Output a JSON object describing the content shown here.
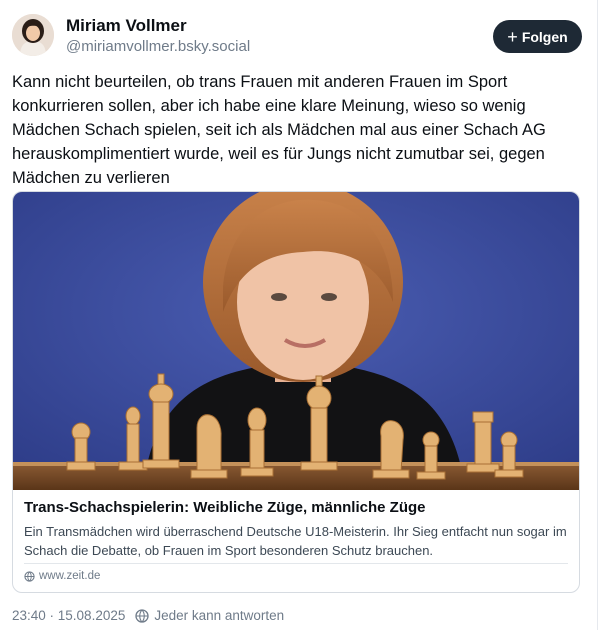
{
  "author": {
    "name": "Miriam Vollmer",
    "handle": "@miriamvollmer.bsky.social"
  },
  "follow_button": {
    "label": "Folgen",
    "icon": "plus-icon"
  },
  "post": {
    "text": "Kann nicht beurteilen, ob trans Frauen mit anderen Frauen im Sport konkurrieren sollen, aber ich habe eine klare Meinung, wieso so wenig Mädchen Schach spielen, seit ich als Mädchen mal aus einer Schach AG herauskomplimentiert wurde, weil es für Jungs nicht zumutbar sei, gegen Mädchen zu verlieren"
  },
  "link_card": {
    "title": "Trans-Schachspielerin: Weibliche Züge, männliche Züge",
    "description": "Ein Transmädchen wird überraschend Deutsche U18-Meisterin. Ihr Sieg entfacht nun sogar im Schach die Debatte, ob Frauen im Sport besonderen Schutz brauchen.",
    "domain": "www.zeit.de",
    "image_icon": "chess-photo"
  },
  "footer": {
    "timestamp": "23:40 · 15.08.2025",
    "reply_setting": "Jeder kann antworten",
    "reply_icon": "globe-icon"
  },
  "colors": {
    "text": "#0b0f14",
    "muted": "#6f7b89",
    "button_bg": "#1e2935",
    "photo_background": "#3d4fa0"
  }
}
